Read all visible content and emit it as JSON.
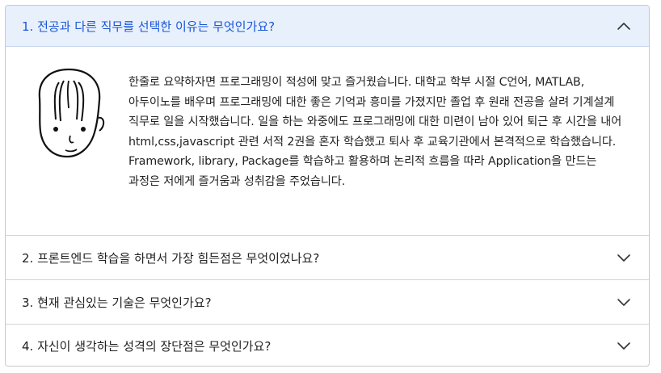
{
  "faq": {
    "items": [
      {
        "question": "1. 전공과 다른 직무를 선택한 이유는 무엇인가요?",
        "expanded": true,
        "answer": "한줄로 요약하자면 프로그래밍이 적성에 맞고 즐거웠습니다. 대학교 학부 시절 C언어, MATLAB, 아두이노를 배우며 프로그래밍에 대한 좋은 기억과 흥미를 가졌지만 졸업 후 원래 전공을 살려 기계설계 직무로 일을 시작했습니다. 일을 하는 와중에도 프로그래밍에 대한 미련이 남아 있어 퇴근 후 시간을 내어 html,css,javascript 관련 서적 2권을 혼자 학습했고 퇴사 후 교육기관에서 본격적으로 학습했습니다. Framework, library, Package를 학습하고 활용하며 논리적 흐름을 따라 Application을 만드는 과정은 저에게 즐거움과 성취감을 주었습니다.",
        "icon": "chevron-up-icon"
      },
      {
        "question": "2. 프론트엔드 학습을 하면서 가장 힘든점은 무엇이었나요?",
        "expanded": false,
        "icon": "chevron-down-icon"
      },
      {
        "question": "3. 현재 관심있는 기술은 무엇인가요?",
        "expanded": false,
        "icon": "chevron-down-icon"
      },
      {
        "question": "4. 자신이 생각하는 성격의 장단점은 무엇인가요?",
        "expanded": false,
        "icon": "chevron-down-icon"
      }
    ]
  },
  "colors": {
    "active_header_bg": "#e8f0fc",
    "active_text": "#1a56d6",
    "text": "#222222",
    "border": "#c9c9c9"
  }
}
